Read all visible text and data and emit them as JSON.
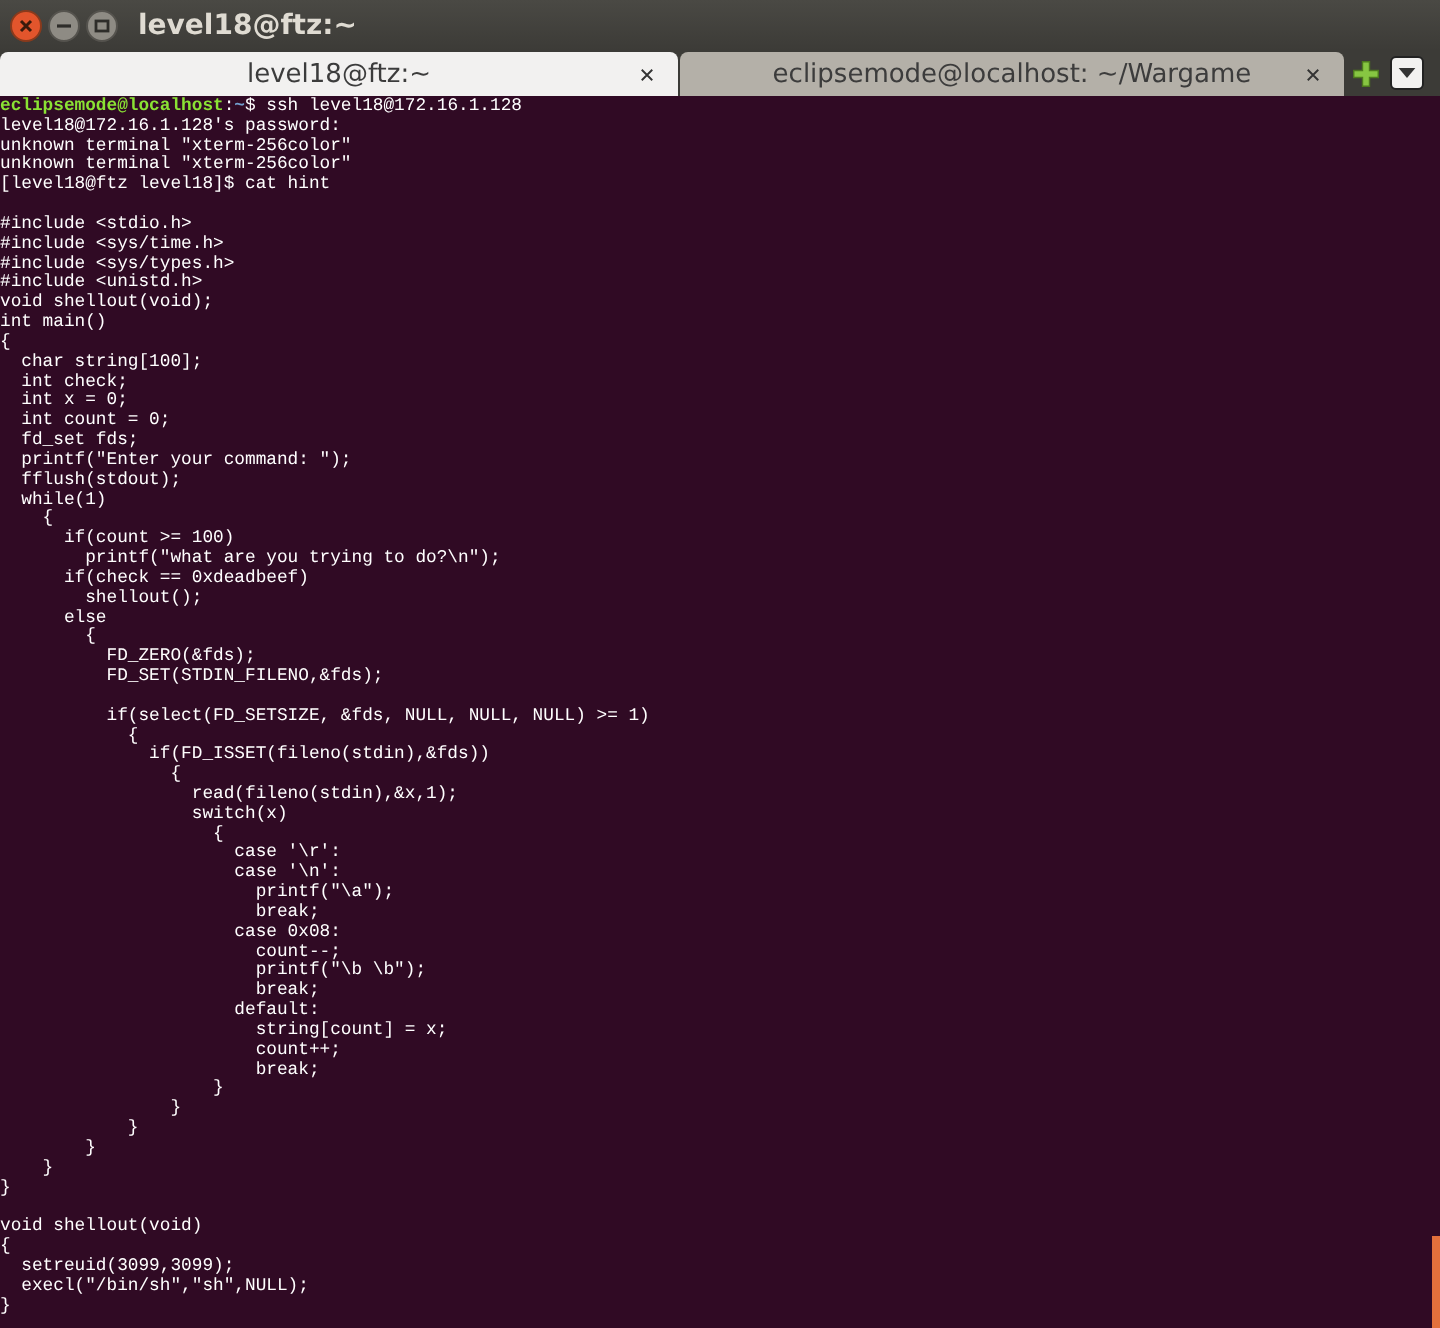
{
  "window": {
    "title": "level18@ftz:~"
  },
  "tabs": [
    {
      "label": "level18@ftz:~",
      "selected": true
    },
    {
      "label": "eclipsemode@localhost: ~/Wargame",
      "selected": false
    }
  ],
  "terminal": {
    "lines": [
      {
        "kind": "prompt",
        "user_host": "eclipsemode@localhost",
        "separator": ":",
        "path": "~",
        "command": "$ ssh level18@172.16.1.128"
      },
      {
        "kind": "text",
        "text": "level18@172.16.1.128's password:"
      },
      {
        "kind": "text",
        "text": "unknown terminal \"xterm-256color\""
      },
      {
        "kind": "text",
        "text": "unknown terminal \"xterm-256color\""
      },
      {
        "kind": "text",
        "text": "[level18@ftz level18]$ cat hint"
      },
      {
        "kind": "blank"
      },
      {
        "kind": "text",
        "text": "#include <stdio.h>"
      },
      {
        "kind": "text",
        "text": "#include <sys/time.h>"
      },
      {
        "kind": "text",
        "text": "#include <sys/types.h>"
      },
      {
        "kind": "text",
        "text": "#include <unistd.h>"
      },
      {
        "kind": "text",
        "text": "void shellout(void);"
      },
      {
        "kind": "text",
        "text": "int main()"
      },
      {
        "kind": "text",
        "text": "{"
      },
      {
        "kind": "text",
        "text": "  char string[100];"
      },
      {
        "kind": "text",
        "text": "  int check;"
      },
      {
        "kind": "text",
        "text": "  int x = 0;"
      },
      {
        "kind": "text",
        "text": "  int count = 0;"
      },
      {
        "kind": "text",
        "text": "  fd_set fds;"
      },
      {
        "kind": "text",
        "text": "  printf(\"Enter your command: \");"
      },
      {
        "kind": "text",
        "text": "  fflush(stdout);"
      },
      {
        "kind": "text",
        "text": "  while(1)"
      },
      {
        "kind": "text",
        "text": "    {"
      },
      {
        "kind": "text",
        "text": "      if(count >= 100)"
      },
      {
        "kind": "text",
        "text": "        printf(\"what are you trying to do?\\n\");"
      },
      {
        "kind": "text",
        "text": "      if(check == 0xdeadbeef)"
      },
      {
        "kind": "text",
        "text": "        shellout();"
      },
      {
        "kind": "text",
        "text": "      else"
      },
      {
        "kind": "text",
        "text": "        {"
      },
      {
        "kind": "text",
        "text": "          FD_ZERO(&fds);"
      },
      {
        "kind": "text",
        "text": "          FD_SET(STDIN_FILENO,&fds);"
      },
      {
        "kind": "blank"
      },
      {
        "kind": "text",
        "text": "          if(select(FD_SETSIZE, &fds, NULL, NULL, NULL) >= 1)"
      },
      {
        "kind": "text",
        "text": "            {"
      },
      {
        "kind": "text",
        "text": "              if(FD_ISSET(fileno(stdin),&fds))"
      },
      {
        "kind": "text",
        "text": "                {"
      },
      {
        "kind": "text",
        "text": "                  read(fileno(stdin),&x,1);"
      },
      {
        "kind": "text",
        "text": "                  switch(x)"
      },
      {
        "kind": "text",
        "text": "                    {"
      },
      {
        "kind": "text",
        "text": "                      case '\\r':"
      },
      {
        "kind": "text",
        "text": "                      case '\\n':"
      },
      {
        "kind": "text",
        "text": "                        printf(\"\\a\");"
      },
      {
        "kind": "text",
        "text": "                        break;"
      },
      {
        "kind": "text",
        "text": "                      case 0x08:"
      },
      {
        "kind": "text",
        "text": "                        count--;"
      },
      {
        "kind": "text",
        "text": "                        printf(\"\\b \\b\");"
      },
      {
        "kind": "text",
        "text": "                        break;"
      },
      {
        "kind": "text",
        "text": "                      default:"
      },
      {
        "kind": "text",
        "text": "                        string[count] = x;"
      },
      {
        "kind": "text",
        "text": "                        count++;"
      },
      {
        "kind": "text",
        "text": "                        break;"
      },
      {
        "kind": "text",
        "text": "                    }"
      },
      {
        "kind": "text",
        "text": "                }"
      },
      {
        "kind": "text",
        "text": "            }"
      },
      {
        "kind": "text",
        "text": "        }"
      },
      {
        "kind": "text",
        "text": "    }"
      },
      {
        "kind": "text",
        "text": "}"
      },
      {
        "kind": "blank"
      },
      {
        "kind": "text",
        "text": "void shellout(void)"
      },
      {
        "kind": "text",
        "text": "{"
      },
      {
        "kind": "text",
        "text": "  setreuid(3099,3099);"
      },
      {
        "kind": "text",
        "text": "  execl(\"/bin/sh\",\"sh\",NULL);"
      },
      {
        "kind": "text",
        "text": "}"
      }
    ]
  }
}
